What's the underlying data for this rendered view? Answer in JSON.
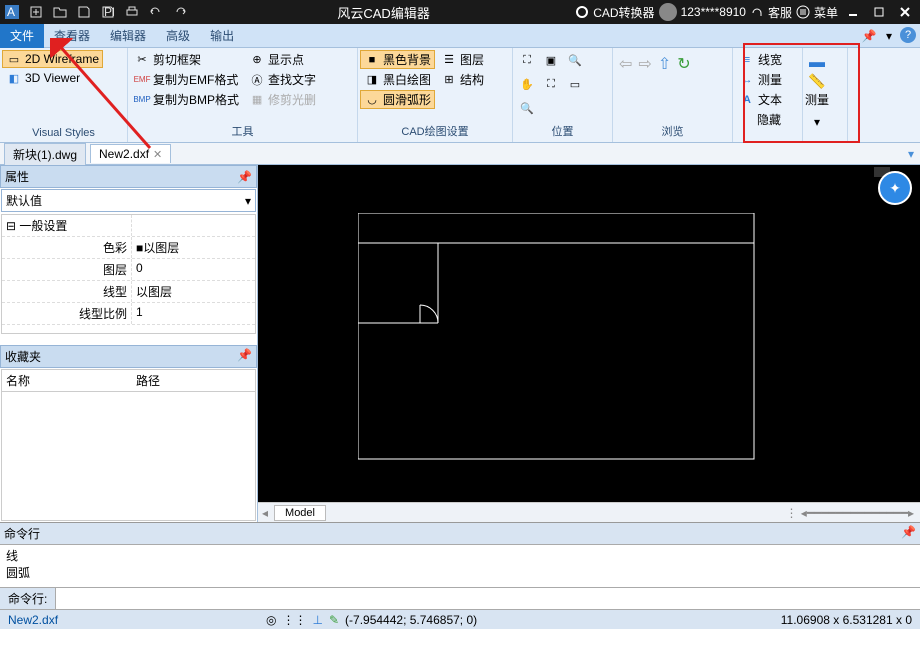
{
  "title": "风云CAD编辑器",
  "titlebar_right": {
    "converter": "CAD转换器",
    "user": "123****8910",
    "support": "客服",
    "menu": "菜单"
  },
  "menus": [
    "文件",
    "查看器",
    "编辑器",
    "高级",
    "输出"
  ],
  "ribbon": {
    "visual": {
      "wireframe": "2D Wireframe",
      "viewer3d": "3D Viewer",
      "label": "Visual Styles"
    },
    "tools": {
      "cut": "剪切框架",
      "emf": "复制为EMF格式",
      "bmp": "复制为BMP格式",
      "point": "显示点",
      "findtxt": "查找文字",
      "trim": "修剪光删",
      "label": "工具"
    },
    "cad": {
      "black": "黑色背景",
      "bw": " 黑白绘图",
      "arc": "圆滑弧形",
      "layer": "图层",
      "struct": "结构",
      "label": "CAD绘图设置"
    },
    "pos": {
      "label": "位置"
    },
    "browse": {
      "label": "浏览"
    },
    "extra": {
      "lw": "线宽",
      "measure": "测量",
      "text": "文本",
      "hide": "隐藏",
      "m2": "测量"
    }
  },
  "tabs": [
    {
      "name": "新块(1).dwg"
    },
    {
      "name": "New2.dxf"
    }
  ],
  "props": {
    "hdr": "属性",
    "default": "默认值",
    "section": "一般设置",
    "rows": [
      {
        "k": "色彩",
        "v": "■以图层"
      },
      {
        "k": "图层",
        "v": "0"
      },
      {
        "k": "线型",
        "v": "以图层"
      },
      {
        "k": "线型比例",
        "v": "1"
      }
    ]
  },
  "fav": {
    "hdr": "收藏夹",
    "col1": "名称",
    "col2": "路径"
  },
  "model": "Model",
  "cmd": {
    "hdr": "命令行",
    "lines": [
      "线",
      "圆弧"
    ],
    "prompt": "命令行:"
  },
  "status": {
    "file": "New2.dxf",
    "coords": "(-7.954442; 5.746857; 0)",
    "right": "11.06908 x 6.531281 x 0"
  }
}
